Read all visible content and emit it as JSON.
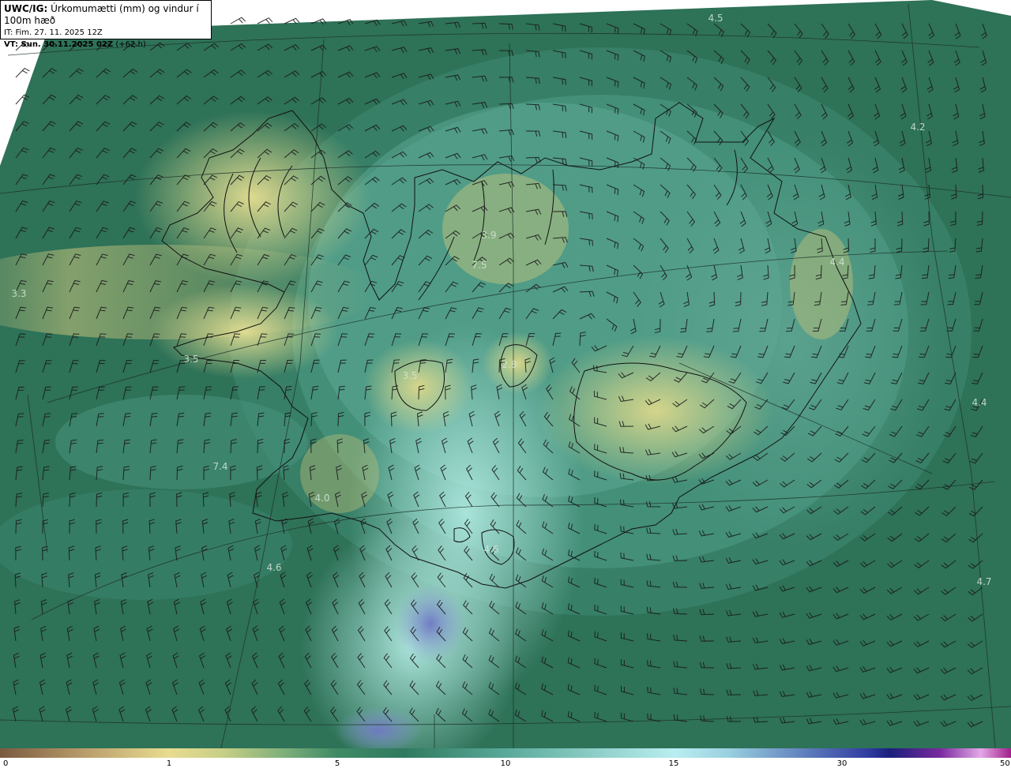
{
  "header": {
    "model": "UWC/IG:",
    "title": "Úrkomumætti (mm) og vindur í 100m hæð",
    "it_line": "IT: Fim. 27. 11. 2025 12Z",
    "vt_prefix": "VT: Sun. 30.11.2025 02Z",
    "vt_offset": "(+62 h)"
  },
  "colors": {
    "sea_base": "#2e7258",
    "land_yellow": "#cfcf80",
    "light_teal": "#a8e4dc",
    "blue_patch": "#6f78c4",
    "barb": "#1a1a1a"
  },
  "value_labels": [
    "4.5",
    "4.2",
    "3.3",
    "3.9",
    "7.5",
    "4.4",
    "4.4",
    "2.8",
    "3.5",
    "4.0",
    "4.6",
    "4.6",
    "4.7",
    "7.4",
    "3.5"
  ],
  "colorbar": {
    "ticks": [
      "0",
      "1",
      "5",
      "10",
      "15",
      "30",
      "50"
    ]
  }
}
